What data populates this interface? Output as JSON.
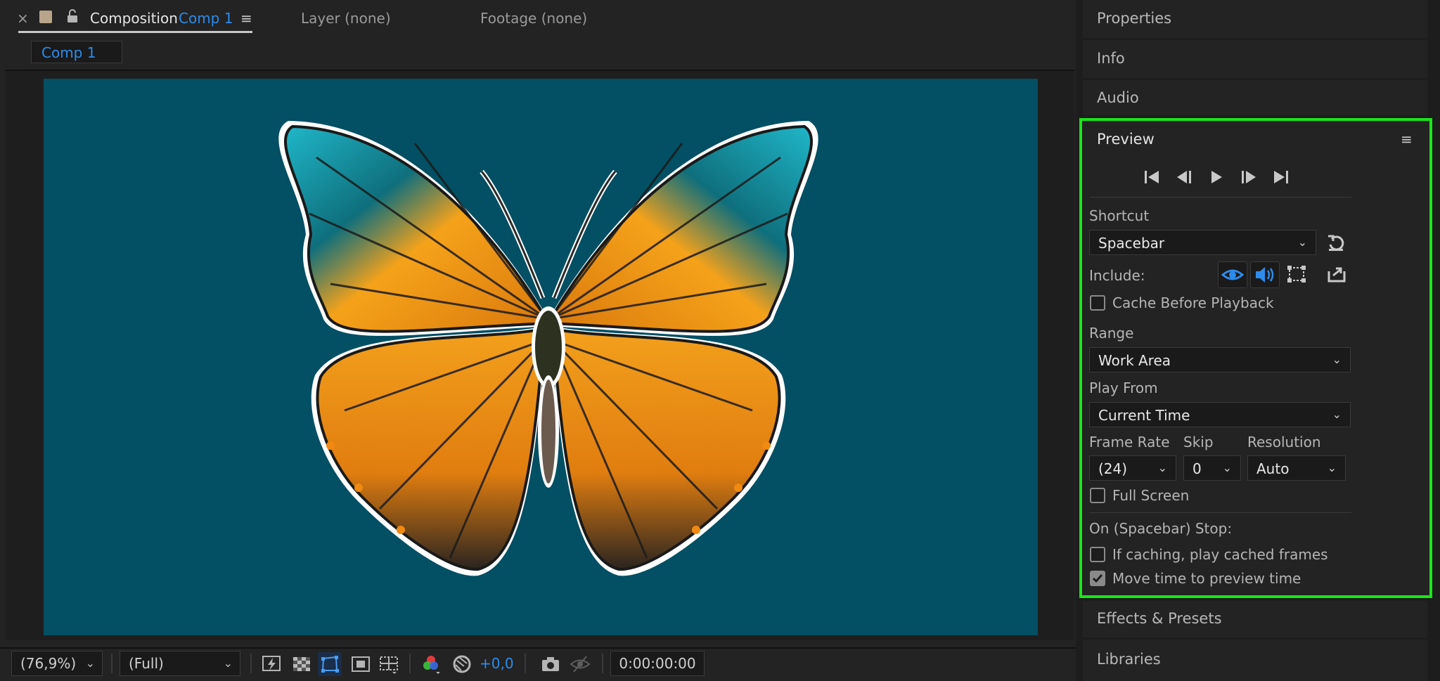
{
  "composition_panel": {
    "tab_label": "Composition",
    "tab_comp_name": "Comp 1",
    "layer_tab": "Layer (none)",
    "footage_tab": "Footage (none)",
    "subtab": "Comp 1",
    "canvas_color": "#034f63"
  },
  "toolbar": {
    "zoom": "(76,9%)",
    "resolution": "(Full)",
    "exposure": "+0,0",
    "timecode": "0:00:00:00"
  },
  "right_panels": {
    "properties": "Properties",
    "info": "Info",
    "audio": "Audio",
    "effects": "Effects & Presets",
    "libraries": "Libraries"
  },
  "preview": {
    "title": "Preview",
    "shortcut_label": "Shortcut",
    "shortcut_value": "Spacebar",
    "include_label": "Include:",
    "cache_label": "Cache Before Playback",
    "range_label": "Range",
    "range_value": "Work Area",
    "play_from_label": "Play From",
    "play_from_value": "Current Time",
    "frame_rate_label": "Frame Rate",
    "frame_rate_value": "(24)",
    "skip_label": "Skip",
    "skip_value": "0",
    "resolution_label": "Resolution",
    "resolution_value": "Auto",
    "fullscreen_label": "Full Screen",
    "on_stop_label": "On (Spacebar) Stop:",
    "if_caching_label": "If caching, play cached frames",
    "move_time_label": "Move time to preview time",
    "move_time_checked": true,
    "highlight_color": "#19e619",
    "accent_color": "#2d8ceb"
  }
}
